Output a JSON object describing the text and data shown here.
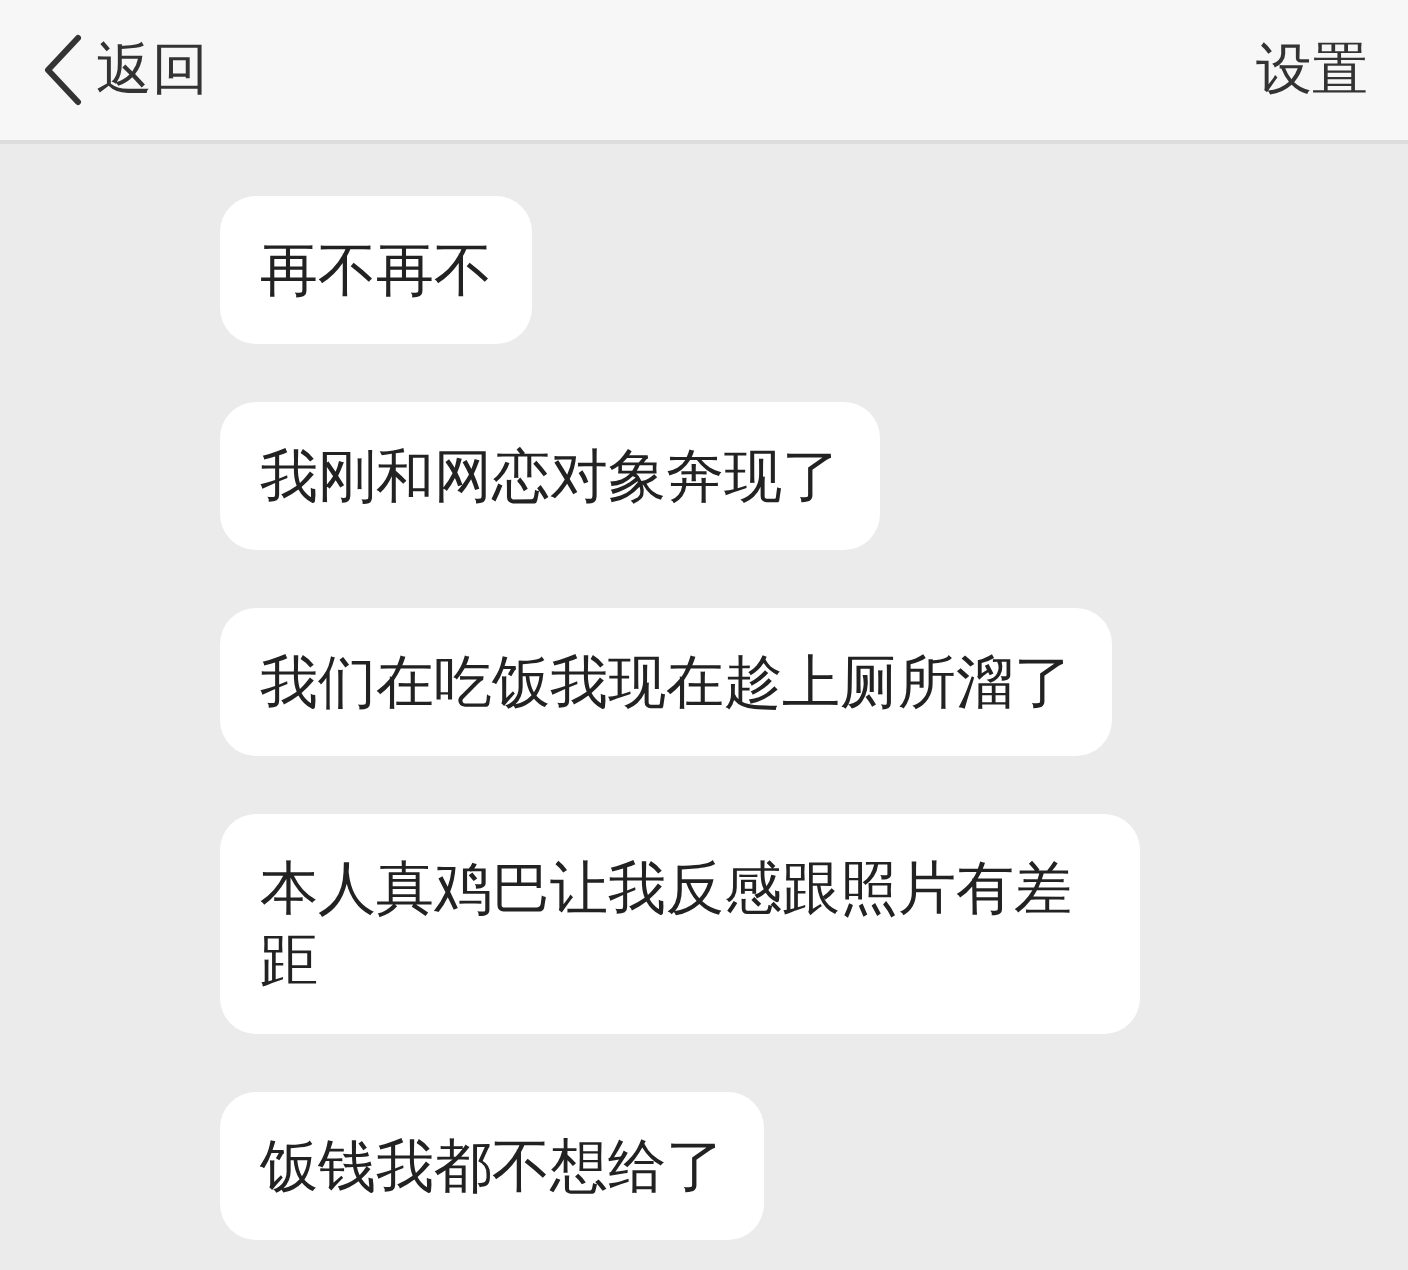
{
  "header": {
    "back_label": "返回",
    "settings_label": "设置"
  },
  "messages": [
    {
      "text": "再不再不"
    },
    {
      "text": "我刚和网恋对象奔现了"
    },
    {
      "text": "我们在吃饭我现在趁上厕所溜了"
    },
    {
      "text": "本人真鸡巴让我反感跟照片有差距"
    },
    {
      "text": "饭钱我都不想给了"
    }
  ]
}
